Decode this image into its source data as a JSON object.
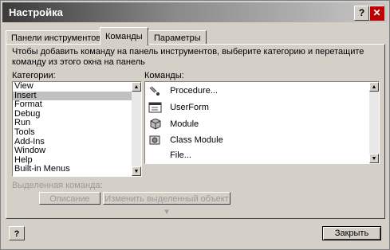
{
  "title": "Настройка",
  "titlebar": {
    "help_label": "?",
    "close_label": "✕"
  },
  "tabs": [
    {
      "label": "Панели инструментов"
    },
    {
      "label": "Команды"
    },
    {
      "label": "Параметры"
    }
  ],
  "description": "Чтобы добавить команду на панель инструментов, выберите категорию и перетащите команду из этого окна на панель",
  "categories_label": "Категории:",
  "commands_label": "Команды:",
  "categories": [
    "View",
    "Insert",
    "Format",
    "Debug",
    "Run",
    "Tools",
    "Add-Ins",
    "Window",
    "Help",
    "Built-in Menus"
  ],
  "selected_category": "Insert",
  "commands": [
    {
      "label": "Procedure...",
      "icon": "procedure-icon"
    },
    {
      "label": "UserForm",
      "icon": "userform-icon"
    },
    {
      "label": "Module",
      "icon": "module-icon"
    },
    {
      "label": "Class Module",
      "icon": "class-module-icon"
    },
    {
      "label": "File...",
      "icon": "file-icon"
    }
  ],
  "selected_command_label": "Выделенная команда:",
  "description_button": "Описание",
  "modify_selection_button": "Изменить выделенный объект",
  "close_button": "Закрыть",
  "help_button_label": "?"
}
